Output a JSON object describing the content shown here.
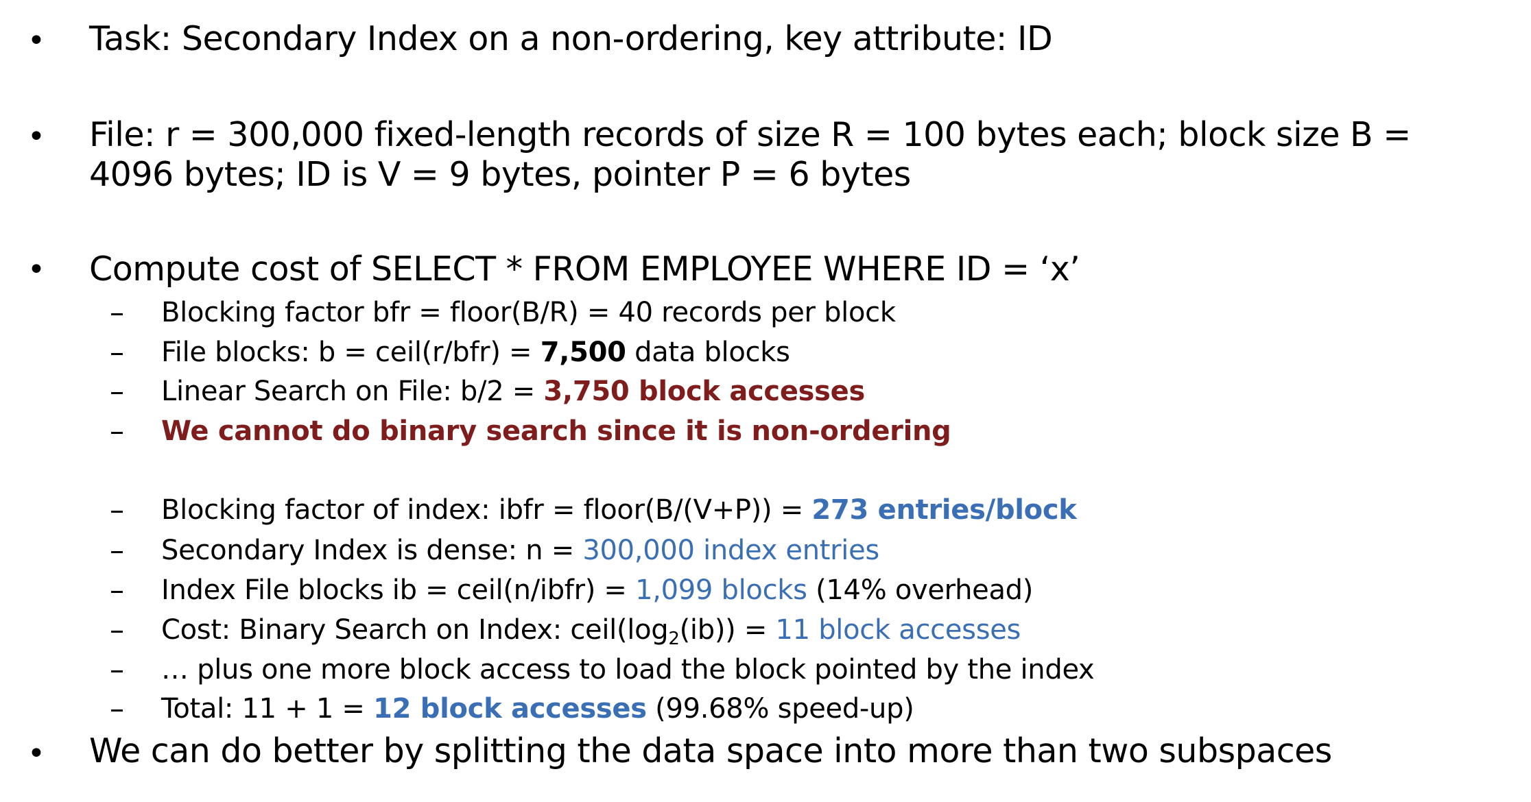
{
  "bullets": {
    "task": "Task: Secondary Index on a non-ordering, key attribute: ID",
    "file_line1": "File: r = 300,000 fixed-length records of size R = 100 bytes each; block size B =",
    "file_line2": "4096 bytes; ID is V = 9 bytes, pointer P = 6 bytes",
    "compute": "Compute cost of SELECT * FROM EMPLOYEE WHERE ID = ‘x’",
    "better": "We can do better by splitting the data space into more than two subspaces"
  },
  "sub_items": {
    "bfr": "Blocking factor bfr = floor(B/R) = 40 records per block",
    "blocks_pre": "File blocks: b = ceil(r/bfr) = ",
    "blocks_val": "7,500",
    "blocks_post": " data blocks",
    "linear_pre": "Linear Search on File: b/2 = ",
    "linear_val": "3,750 block accesses",
    "no_binary": "We cannot do binary search since it is non-ordering",
    "ibfr_pre": "Blocking factor of index: ibfr = floor(B/(V+P)) = ",
    "ibfr_val": "273 entries/block",
    "dense_pre": "Secondary Index is dense: n = ",
    "dense_val": "300,000 index entries",
    "ib_pre": "Index File blocks ib = ceil(n/ibfr) = ",
    "ib_val": "1,099 blocks",
    "ib_post": " (14% overhead)",
    "cost_pre": "Cost: Binary Search on Index: ceil(log",
    "cost_sub": "2",
    "cost_mid": "(ib)) = ",
    "cost_val": "11 block accesses",
    "plus": "… plus one more block access to load the block pointed by the index",
    "total_pre": "Total: 11 + 1 = ",
    "total_val": "12 block accesses",
    "total_post": " (99.68% speed-up)"
  },
  "markers": {
    "bullet": "•",
    "dash": "–"
  },
  "colors": {
    "emphasis_red": "#7f1d1d",
    "emphasis_blue": "#3a6fb5"
  }
}
